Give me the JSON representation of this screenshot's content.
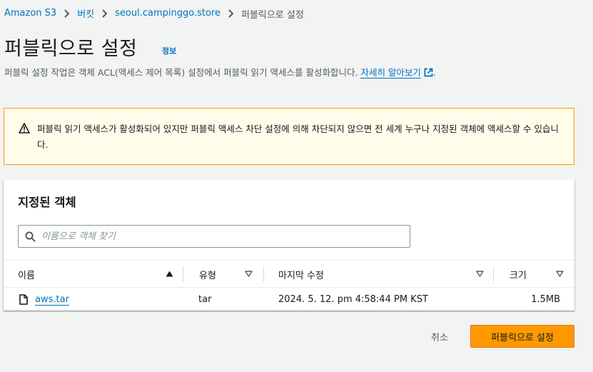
{
  "breadcrumb": {
    "items": [
      "Amazon S3",
      "버킷",
      "seoul.campinggo.store"
    ],
    "current": "퍼블릭으로 설정"
  },
  "header": {
    "title": "퍼블릭으로 설정",
    "info": "정보",
    "description": "퍼블릭 설정 작업은 객체 ACL(액세스 제어 목록) 설정에서 퍼블릭 읽기 액세스를 활성화합니다.",
    "learn_more": "자세히 알아보기",
    "period": "."
  },
  "warning": {
    "text": "퍼블릭 읽기 액세스가 활성화되어 있지만 퍼블릭 액세스 차단 설정에 의해 차단되지 않으면 전 세계 누구나 지정된 객체에 액세스할 수 있습니다."
  },
  "objects_panel": {
    "title": "지정된 객체",
    "search_placeholder": "이름으로 객체 찾기",
    "columns": [
      "이름",
      "유형",
      "마지막 수정",
      "크기"
    ],
    "rows": [
      {
        "name": "aws.tar",
        "type": "tar",
        "modified": "2024. 5. 12. pm 4:58:44 PM KST",
        "size": "1.5MB"
      }
    ]
  },
  "actions": {
    "cancel": "취소",
    "submit": "퍼블릭으로 설정"
  },
  "colors": {
    "link": "#0073bb",
    "primary": "#ff9900",
    "warning_bg": "#fffce9",
    "background": "#f2f3f3"
  }
}
